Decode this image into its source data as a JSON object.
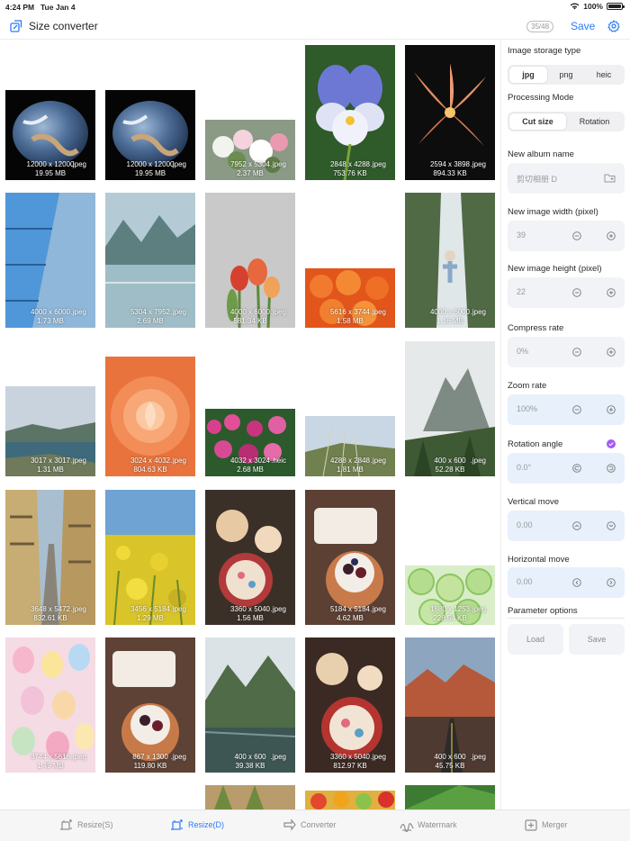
{
  "status": {
    "time": "4:24 PM",
    "date": "Tue Jan 4",
    "battery": "100%"
  },
  "nav": {
    "title": "Size converter",
    "count": "35/48",
    "save": "Save"
  },
  "colors": {
    "accent": "#2a7bf6",
    "check": "#a55cf0"
  },
  "images": [
    {
      "size": "12000 x 12000",
      "fmt": ".jpeg",
      "bytes": "19.95 MB"
    },
    {
      "size": "12000 x 12000",
      "fmt": ".jpeg",
      "bytes": "19.95 MB"
    },
    {
      "size": "7952 x 5304",
      "fmt": ".jpeg",
      "bytes": "2.37 MB"
    },
    {
      "size": "2848 x 4288",
      "fmt": ".jpeg",
      "bytes": "753.76 KB"
    },
    {
      "size": "2594 x 3898",
      "fmt": ".jpeg",
      "bytes": "894.33 KB"
    },
    {
      "size": "4000 x 6000",
      "fmt": ".jpeg",
      "bytes": "1.73 MB"
    },
    {
      "size": "5304 x 7952",
      "fmt": ".jpeg",
      "bytes": "2.69 MB"
    },
    {
      "size": "4000 x 6000",
      "fmt": ".jpeg",
      "bytes": "581.34 KB"
    },
    {
      "size": "5616 x 3744",
      "fmt": ".jpeg",
      "bytes": "1.58 MB"
    },
    {
      "size": "4000 x 6000",
      "fmt": ".jpeg",
      "bytes": "1.16 MB"
    },
    {
      "size": "3017 x 3017",
      "fmt": ".jpeg",
      "bytes": "1.31 MB"
    },
    {
      "size": "3024 x 4032",
      "fmt": ".jpeg",
      "bytes": "804.63 KB"
    },
    {
      "size": "4032 x 3024",
      "fmt": ".heic",
      "bytes": "2.68 MB"
    },
    {
      "size": "4288 x 2848",
      "fmt": ".jpeg",
      "bytes": "1.81 MB"
    },
    {
      "size": "400 x 600",
      "fmt": ".jpeg",
      "bytes": "52.28 KB"
    },
    {
      "size": "3648 x 5472",
      "fmt": ".jpeg",
      "bytes": "832.61 KB"
    },
    {
      "size": "3456 x 5184",
      "fmt": ".jpeg",
      "bytes": "1.29 MB"
    },
    {
      "size": "3360 x 5040",
      "fmt": ".jpeg",
      "bytes": "1.56 MB"
    },
    {
      "size": "5184 x 5184",
      "fmt": ".jpeg",
      "bytes": "4.62 MB"
    },
    {
      "size": "1880 x 1253",
      "fmt": ".jpeg",
      "bytes": "228.54 KB"
    },
    {
      "size": "3744 x 5616",
      "fmt": ".jpeg",
      "bytes": "1.49 MB"
    },
    {
      "size": "867 x 1300",
      "fmt": ".jpeg",
      "bytes": "119.80 KB"
    },
    {
      "size": "400 x 600",
      "fmt": ".jpeg",
      "bytes": "39.38 KB"
    },
    {
      "size": "3360 x 5040",
      "fmt": ".jpeg",
      "bytes": "812.97 KB"
    },
    {
      "size": "400 x 600",
      "fmt": ".jpeg",
      "bytes": "45.75 KB"
    }
  ],
  "panel": {
    "storage_label": "Image storage type",
    "storage_options": [
      "jpg",
      "png",
      "heic"
    ],
    "mode_label": "Processing Mode",
    "mode_options": [
      "Cut size",
      "Rotation"
    ],
    "album_label": "New album name",
    "album_placeholder": "剪切相册 D",
    "width_label": "New image width (pixel)",
    "width_value": "39",
    "height_label": "New image height (pixel)",
    "height_value": "22",
    "compress_label": "Compress rate",
    "compress_value": "0%",
    "zoom_label": "Zoom rate",
    "zoom_value": "100%",
    "rotation_label": "Rotation angle",
    "rotation_value": "0.0°",
    "vmove_label": "Vertical move",
    "vmove_value": "0.00",
    "hmove_label": "Horizontal move",
    "hmove_value": "0.00",
    "params_label": "Parameter options",
    "load_label": "Load",
    "save_label": "Save"
  },
  "tabs": [
    "Resize(S)",
    "Resize(D)",
    "Converter",
    "Watermark",
    "Merger"
  ]
}
